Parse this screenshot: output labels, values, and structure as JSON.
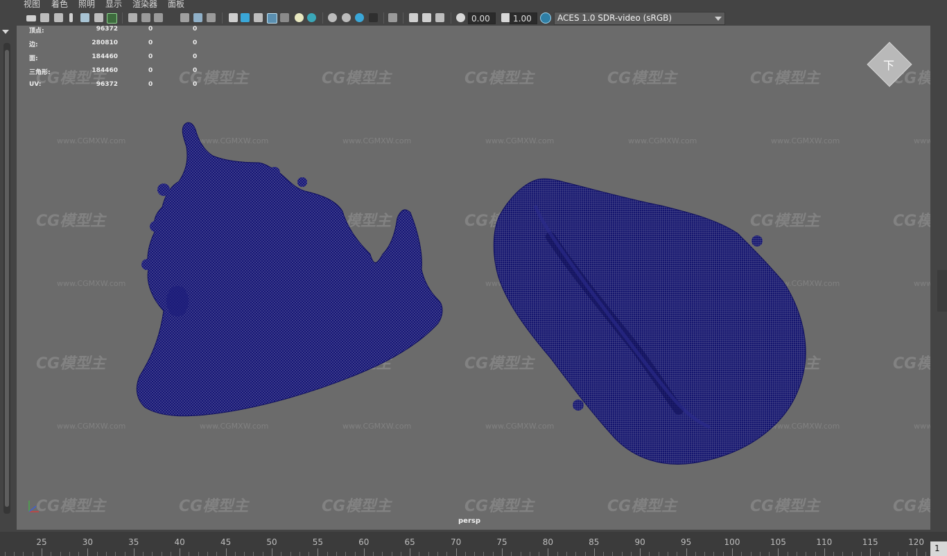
{
  "menu": [
    "视图",
    "着色",
    "照明",
    "显示",
    "渲染器",
    "面板"
  ],
  "toolbar": {
    "exposure_value": "0.00",
    "gamma_value": "1.00",
    "color_management": "ACES 1.0 SDR-video (sRGB)",
    "icons": [
      "camera-icon",
      "camera-attributes-icon",
      "bookmark-icon",
      "image-plane-icon",
      "grid-icon",
      "wireframe-icon",
      "smooth-shade-icon",
      "texture-icon",
      "lights-icon",
      "shadows-icon",
      "xray-icon",
      "isolate-icon",
      "exposure-icon",
      "gamma-icon",
      "color-management-icon"
    ]
  },
  "hud": {
    "rows": [
      {
        "label": "顶点:",
        "v1": "96372",
        "v2": "0",
        "v3": "0"
      },
      {
        "label": "边:",
        "v1": "280810",
        "v2": "0",
        "v3": "0"
      },
      {
        "label": "面:",
        "v1": "184460",
        "v2": "0",
        "v3": "0"
      },
      {
        "label": "三角形:",
        "v1": "184460",
        "v2": "0",
        "v3": "0"
      },
      {
        "label": "UV:",
        "v1": "96372",
        "v2": "0",
        "v3": "0"
      }
    ]
  },
  "viewport": {
    "camera": "persp",
    "viewcube_face": "下",
    "mesh_color": "#151575",
    "watermark_logo": "CG模型主",
    "watermark_url": "www.CGMXW.com"
  },
  "timeline": {
    "ticks": [
      "25",
      "30",
      "35",
      "40",
      "45",
      "50",
      "55",
      "60",
      "65",
      "70",
      "75",
      "80",
      "85",
      "90",
      "95",
      "100",
      "105",
      "110",
      "115",
      "120"
    ],
    "current_frame": "1"
  },
  "colors": {
    "viewport_bg": "#6b6b6b",
    "ui_bg": "#444444",
    "wireframe": "#151575"
  }
}
